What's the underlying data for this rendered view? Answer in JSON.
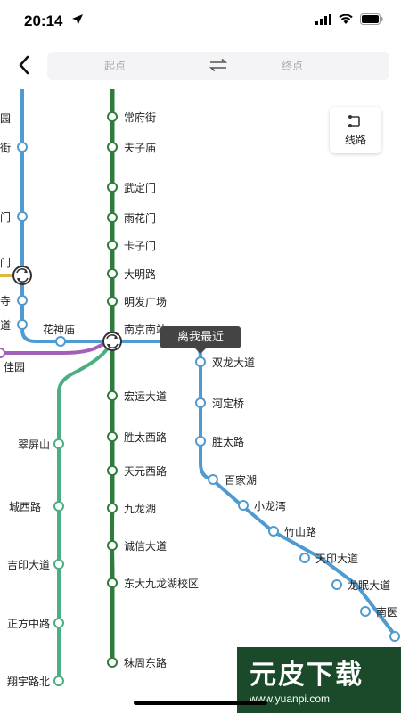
{
  "status_bar": {
    "time": "20:14"
  },
  "search": {
    "start_placeholder": "起点",
    "end_placeholder": "终点"
  },
  "route_button": {
    "label": "线路"
  },
  "tooltip": {
    "text": "离我最近"
  },
  "colors": {
    "line_dark_green": "#2e7d3c",
    "line_blue": "#4f9bd1",
    "line_teal_green": "#4caf82",
    "line_purple": "#a25fb8",
    "line_yellow": "#e0b840"
  },
  "stations": {
    "dark_green_line": [
      "常府街",
      "夫子庙",
      "武定门",
      "雨花门",
      "卡子门",
      "大明路",
      "明发广场",
      "南京南站",
      "宏运大道",
      "胜太西路",
      "天元西路",
      "九龙湖",
      "诚信大道",
      "东大九龙湖校区",
      "秣周东路"
    ],
    "blue_line_right": [
      "双龙大道",
      "河定桥",
      "胜太路",
      "百家湖",
      "小龙湾",
      "竹山路",
      "天印大道",
      "龙眠大道",
      "南医"
    ],
    "left_blue_line": [
      "园",
      "街",
      "门",
      "门",
      "寺",
      "道"
    ],
    "horizontal": [
      "花神庙"
    ],
    "teal_line": [
      "翠屏山",
      "城西路",
      "吉印大道",
      "正方中路",
      "翔宇路北"
    ],
    "purple_line": [
      "佳园"
    ]
  },
  "watermark": {
    "title": "元皮下载",
    "url": "www.yuanpi.com"
  },
  "icons": [
    "location-arrow-icon",
    "signal-icon",
    "wifi-icon",
    "battery-icon",
    "back-arrow-icon",
    "swap-icon",
    "route-icon",
    "transfer-icon"
  ]
}
